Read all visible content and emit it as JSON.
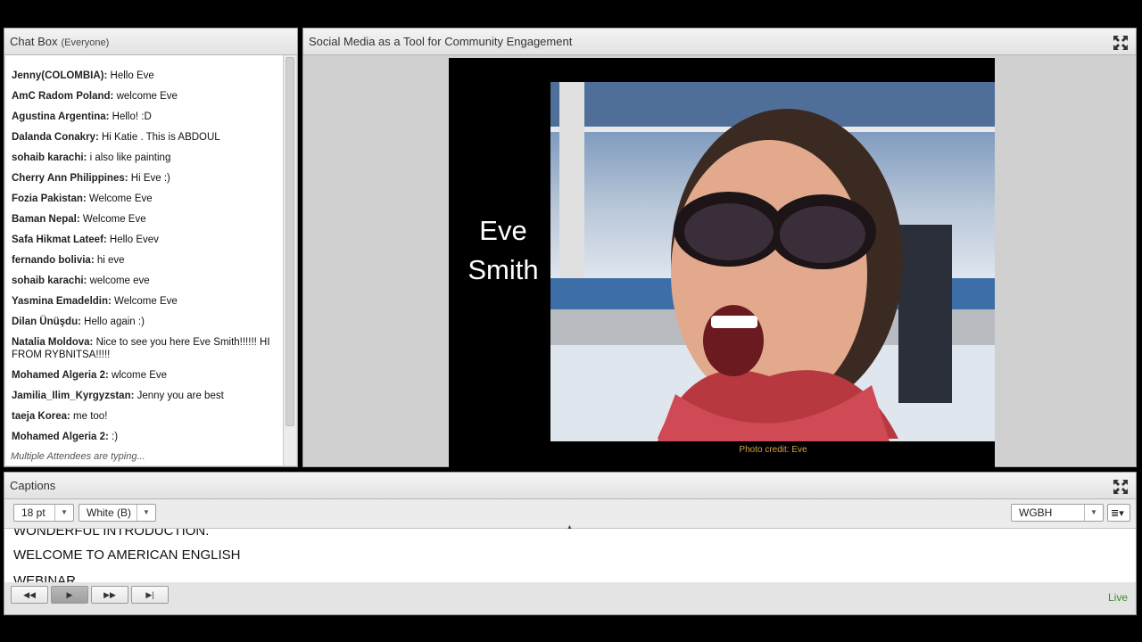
{
  "chat": {
    "title": "Chat Box",
    "scope": "(Everyone)",
    "messages": [
      {
        "who": "Jenny(COLOMBIA):",
        "text": " Hello Eve"
      },
      {
        "who": "AmC Radom Poland:",
        "text": " welcome Eve"
      },
      {
        "who": "Agustina Argentina:",
        "text": " Hello! :D"
      },
      {
        "who": "Dalanda Conakry:",
        "text": " Hi Katie . This is ABDOUL"
      },
      {
        "who": "sohaib karachi:",
        "text": " i also like painting"
      },
      {
        "who": "Cherry Ann Philippines:",
        "text": " Hi Eve :)"
      },
      {
        "who": "Fozia Pakistan:",
        "text": " Welcome Eve"
      },
      {
        "who": "Baman Nepal:",
        "text": " Welcome Eve"
      },
      {
        "who": "Safa Hikmat Lateef:",
        "text": " Hello Evev"
      },
      {
        "who": "fernando bolivia:",
        "text": " hi eve"
      },
      {
        "who": "sohaib karachi:",
        "text": " welcome eve"
      },
      {
        "who": "Yasmina Emadeldin:",
        "text": " Welcome Eve"
      },
      {
        "who": "Dilan Ünüşdu:",
        "text": " Hello again :)"
      },
      {
        "who": "Natalia Moldova:",
        "text": " Nice to see you here Eve Smith!!!!!! HI FROM RYBNITSA!!!!!"
      },
      {
        "who": "Mohamed Algeria 2:",
        "text": " wlcome Eve"
      },
      {
        "who": "Jamilia_Ilim_Kyrgyzstan:",
        "text": " Jenny you are best"
      },
      {
        "who": "taeja Korea:",
        "text": " me too!"
      },
      {
        "who": "Mohamed Algeria 2:",
        "text": " :)"
      }
    ],
    "typing": "Multiple Attendees are typing..."
  },
  "share": {
    "title": "Social Media as a Tool for Community Engagement",
    "speaker_first": "Eve",
    "speaker_last": "Smith",
    "credit": "Photo credit: Eve"
  },
  "captions": {
    "title": "Captions",
    "font_size": "18 pt",
    "color": "White (B)",
    "provider": "WGBH",
    "lines": [
      "WONDERFUL INTRODUCTION.",
      "WELCOME TO AMERICAN ENGLISH",
      "WEBINAR."
    ],
    "status": "Live"
  },
  "colors": {
    "live": "#3d8b2a",
    "credit": "#d4a24a"
  }
}
